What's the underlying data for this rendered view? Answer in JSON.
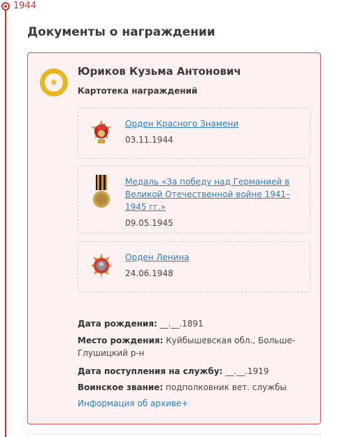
{
  "timeline": {
    "year": "1944"
  },
  "section": {
    "title": "Документы о награждении"
  },
  "card": {
    "name": "Юриков Кузьма Антонович",
    "subtitle": "Картотека награждений",
    "awards": [
      {
        "title": "Орден Красного Знамени",
        "date": "03.11.1944",
        "icon": "order-red-banner-icon"
      },
      {
        "title": "Медаль «За победу над Германией в Великой Отечественной войне 1941–1945 гг.»",
        "date": "09.05.1945",
        "icon": "victory-medal-icon"
      },
      {
        "title": "Орден Ленина",
        "date": "24.06.1948",
        "icon": "order-lenin-icon"
      }
    ],
    "info": {
      "birth_date_label": "Дата рождения:",
      "birth_date_value": "__.__.1891",
      "birth_place_label": "Место рождения:",
      "birth_place_value": "Куйбышевская обл., Больше-Глушицкий р-н",
      "service_date_label": "Дата поступления на службу:",
      "service_date_value": "__.__.1919",
      "rank_label": "Воинское звание:",
      "rank_value": "подполковник вет. службы"
    },
    "archive_link": "Информация об архиве+"
  },
  "colors": {
    "accent": "#d0352a",
    "link": "#2a7dc9",
    "card_bg": "#fdf2f1",
    "badge": "#e8b61e"
  }
}
